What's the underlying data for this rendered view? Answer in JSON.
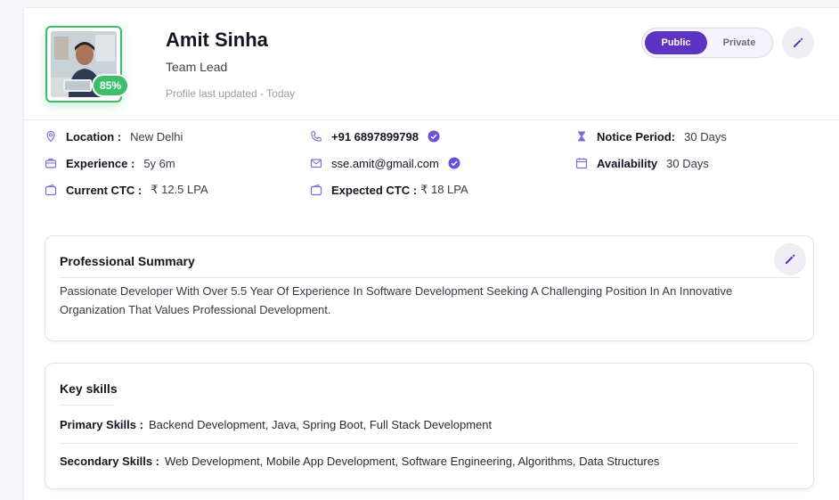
{
  "profile": {
    "name": "Amit Sinha",
    "role": "Team Lead",
    "updated": "Profile last updated - Today",
    "completion": "85%"
  },
  "visibility": {
    "public_label": "Public",
    "private_label": "Private",
    "selected": "Public"
  },
  "info": {
    "location": {
      "label": "Location :",
      "value": "New Delhi"
    },
    "experience": {
      "label": "Experience :",
      "value": "5y 6m"
    },
    "current_ctc": {
      "label": "Current CTC :",
      "value": "₹ 12.5 LPA"
    },
    "phone": {
      "value": "+91 6897899798"
    },
    "email": {
      "value": "sse.amit@gmail.com"
    },
    "expected_ctc": {
      "label": "Expected CTC :",
      "value": "₹ 18 LPA"
    },
    "notice": {
      "label": "Notice Period:",
      "value": "30 Days"
    },
    "availability": {
      "label": "Availability",
      "value": "30 Days"
    }
  },
  "summary": {
    "title": "Professional Summary",
    "text": "Passionate Developer With Over 5.5 Year Of Experience In Software Development Seeking A Challenging Position In An Innovative Organization That Values Professional Development."
  },
  "skills": {
    "title": "Key skills",
    "primary_label": "Primary Skills :",
    "primary_value": "Backend Development, Java, Spring Boot, Full Stack Development",
    "secondary_label": "Secondary Skills :",
    "secondary_value": "Web Development, Mobile App Development, Software Engineering, Algorithms, Data Structures"
  },
  "colors": {
    "accent": "#5b34c4",
    "success": "#3bbf68",
    "icon": "#7b6fd6"
  }
}
